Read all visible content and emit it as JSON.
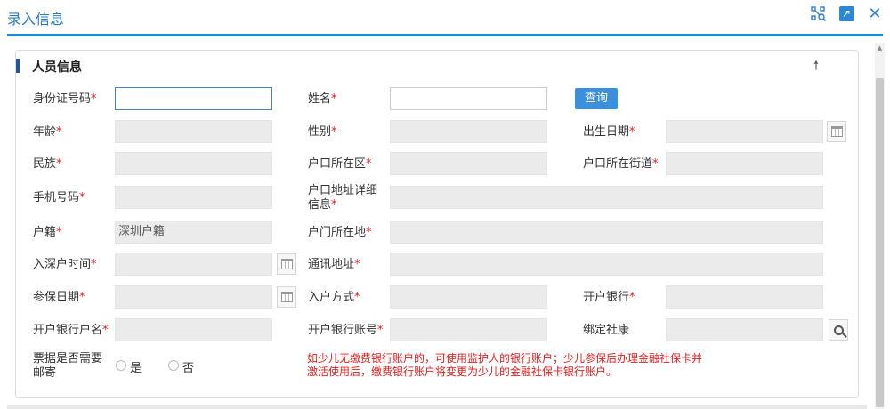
{
  "window": {
    "title": "录入信息"
  },
  "section": {
    "title": "人员信息",
    "collapse_glyph": "🠕"
  },
  "req_mark": "*",
  "fields": {
    "id_number": {
      "label": "身份证号码",
      "value": ""
    },
    "name": {
      "label": "姓名",
      "value": ""
    },
    "age": {
      "label": "年龄",
      "value": ""
    },
    "gender": {
      "label": "性别",
      "value": ""
    },
    "birth_date": {
      "label": "出生日期",
      "value": ""
    },
    "ethnicity": {
      "label": "民族",
      "value": ""
    },
    "hukou_district": {
      "label": "户口所在区",
      "value": ""
    },
    "hukou_street": {
      "label": "户口所在街道",
      "value": ""
    },
    "mobile": {
      "label": "手机号码",
      "value": ""
    },
    "hukou_address_detail": {
      "label": "户口地址详细信息",
      "value": ""
    },
    "household_registration": {
      "label": "户籍",
      "value": "深圳户籍"
    },
    "hukou_location": {
      "label": "户门所在地",
      "value": ""
    },
    "sz_hukou_time": {
      "label": "入深户时间",
      "value": ""
    },
    "mailing_address": {
      "label": "通讯地址",
      "value": ""
    },
    "insurance_date": {
      "label": "参保日期",
      "value": ""
    },
    "entry_method": {
      "label": "入户方式",
      "value": ""
    },
    "bank": {
      "label": "开户银行",
      "value": ""
    },
    "account_name": {
      "label": "开户银行户名",
      "value": ""
    },
    "account_number": {
      "label": "开户银行账号",
      "value": ""
    },
    "bind_social_card": {
      "label": "绑定社康",
      "value": ""
    }
  },
  "query_button": "查询",
  "mail_invoice": {
    "label": "票据是否需要邮寄",
    "options": [
      "是",
      "否"
    ]
  },
  "notice": "如少儿无缴费银行账户的，可使用监护人的银行账户；少儿参保后办理金融社保卡并激活使用后，缴费银行账户将变更为少儿的金融社保卡银行账户。"
}
